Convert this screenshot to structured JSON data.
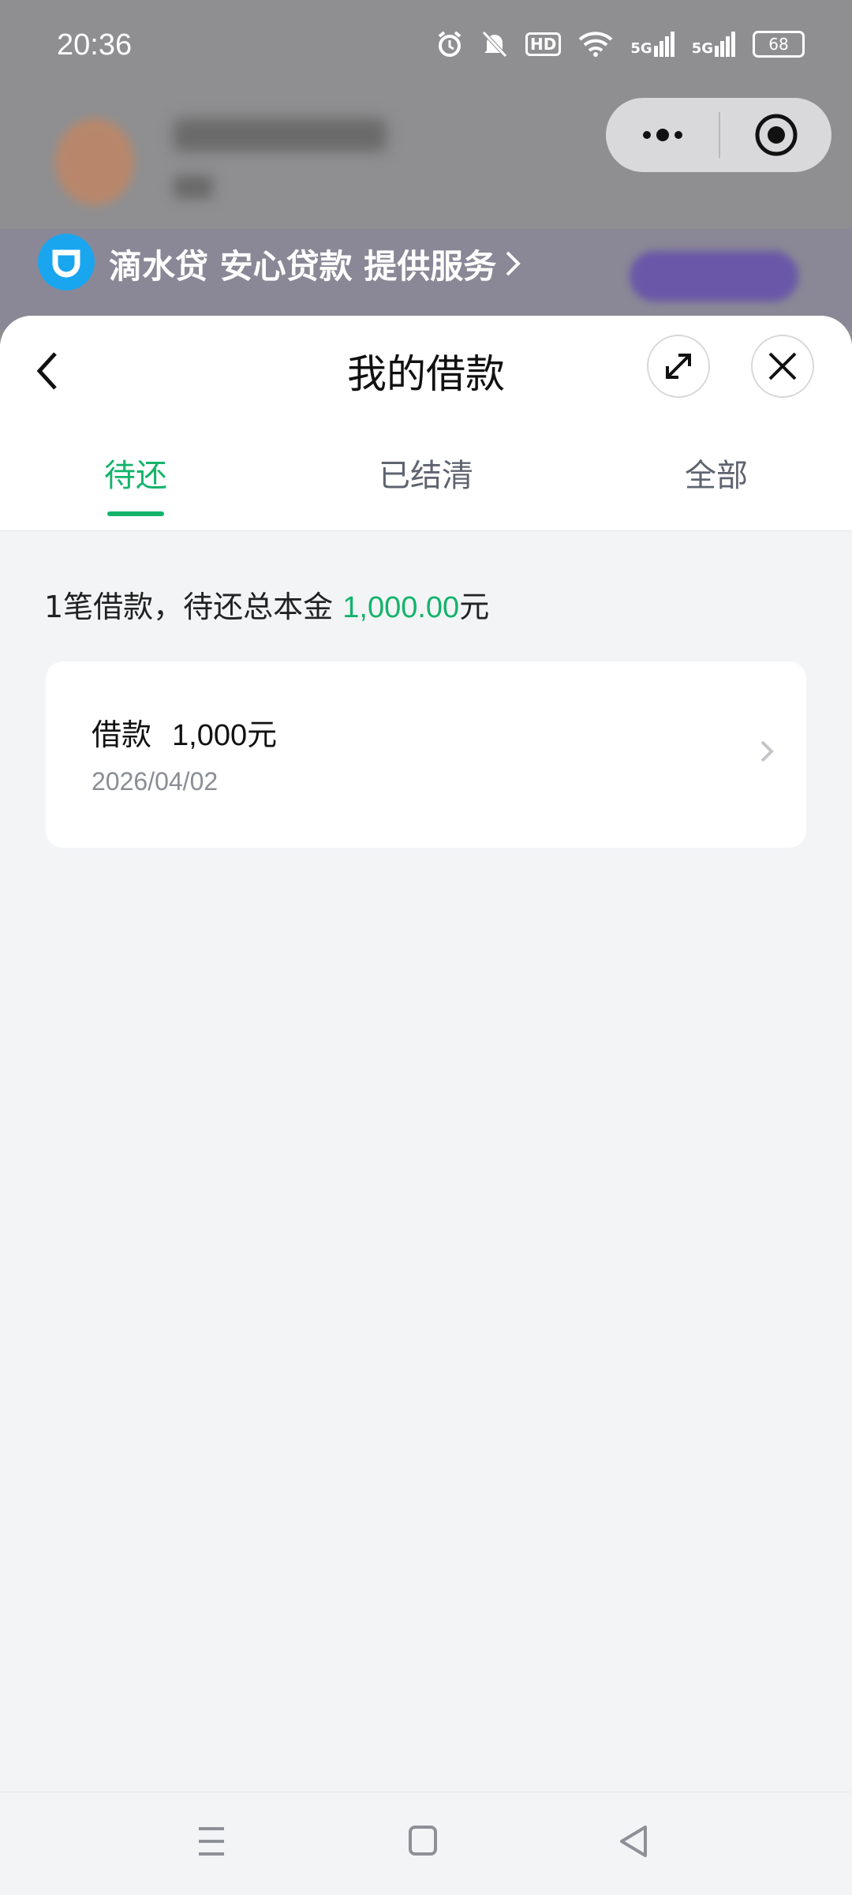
{
  "status_bar": {
    "time": "20:36",
    "battery": "68",
    "network1": "5G",
    "network2": "5G",
    "hd_label": "HD"
  },
  "banner": {
    "text": "滴水贷 安心贷款 提供服务"
  },
  "sheet": {
    "title": "我的借款",
    "tabs": [
      {
        "label": "待还",
        "active": true
      },
      {
        "label": "已结清",
        "active": false
      },
      {
        "label": "全部",
        "active": false
      }
    ],
    "summary_prefix": "1笔借款，待还总本金 ",
    "summary_amount": "1,000.00",
    "summary_suffix": "元",
    "loans": [
      {
        "label": "借款",
        "amount": "1,000元",
        "date": "2026/04/02"
      }
    ]
  },
  "colors": {
    "accent": "#14b36b",
    "sheet_bg": "#f3f4f6",
    "overlay": "#8f8f91"
  }
}
